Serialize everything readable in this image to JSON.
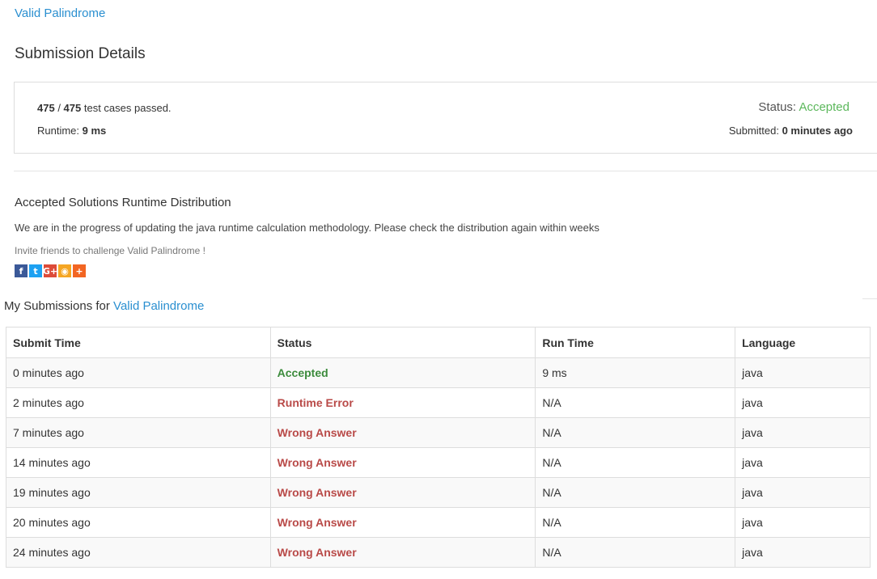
{
  "problem": {
    "title_link": "Valid Palindrome"
  },
  "page_title": "Submission Details",
  "details": {
    "cases_passed": "475",
    "cases_total": "475",
    "cases_sep": " / ",
    "cases_suffix": " test cases passed.",
    "runtime_label": "Runtime: ",
    "runtime_value": "9 ms",
    "status_label": "Status: ",
    "status_value": "Accepted",
    "submitted_label": "Submitted: ",
    "submitted_value": "0 minutes ago"
  },
  "distribution": {
    "title": "Accepted Solutions Runtime Distribution",
    "note": "We are in the progress of updating the java runtime calculation methodology. Please check the distribution again within weeks",
    "invite": "Invite friends to challenge Valid Palindrome !"
  },
  "share": [
    {
      "name": "facebook-icon",
      "glyph": "f",
      "color": "#3b5998"
    },
    {
      "name": "twitter-icon",
      "glyph": "t",
      "color": "#1da1f2"
    },
    {
      "name": "google-plus-icon",
      "glyph": "G+",
      "color": "#dd4b39"
    },
    {
      "name": "weibo-icon",
      "glyph": "◉",
      "color": "#f5a623"
    },
    {
      "name": "more-share-icon",
      "glyph": "+",
      "color": "#f26522"
    }
  ],
  "my_submissions": {
    "label": "My Submissions for ",
    "link": "Valid Palindrome"
  },
  "table": {
    "headers": [
      "Submit Time",
      "Status",
      "Run Time",
      "Language"
    ],
    "rows": [
      {
        "time": "0 minutes ago",
        "status": "Accepted",
        "status_kind": "green",
        "runtime": "9 ms",
        "lang": "java"
      },
      {
        "time": "2 minutes ago",
        "status": "Runtime Error",
        "status_kind": "red",
        "runtime": "N/A",
        "lang": "java"
      },
      {
        "time": "7 minutes ago",
        "status": "Wrong Answer",
        "status_kind": "red",
        "runtime": "N/A",
        "lang": "java"
      },
      {
        "time": "14 minutes ago",
        "status": "Wrong Answer",
        "status_kind": "red",
        "runtime": "N/A",
        "lang": "java"
      },
      {
        "time": "19 minutes ago",
        "status": "Wrong Answer",
        "status_kind": "red",
        "runtime": "N/A",
        "lang": "java"
      },
      {
        "time": "20 minutes ago",
        "status": "Wrong Answer",
        "status_kind": "red",
        "runtime": "N/A",
        "lang": "java"
      },
      {
        "time": "24 minutes ago",
        "status": "Wrong Answer",
        "status_kind": "red",
        "runtime": "N/A",
        "lang": "java"
      }
    ]
  },
  "colors": {
    "link": "#2a8fd0",
    "accepted": "#3c8b3c",
    "error": "#b94a48"
  }
}
